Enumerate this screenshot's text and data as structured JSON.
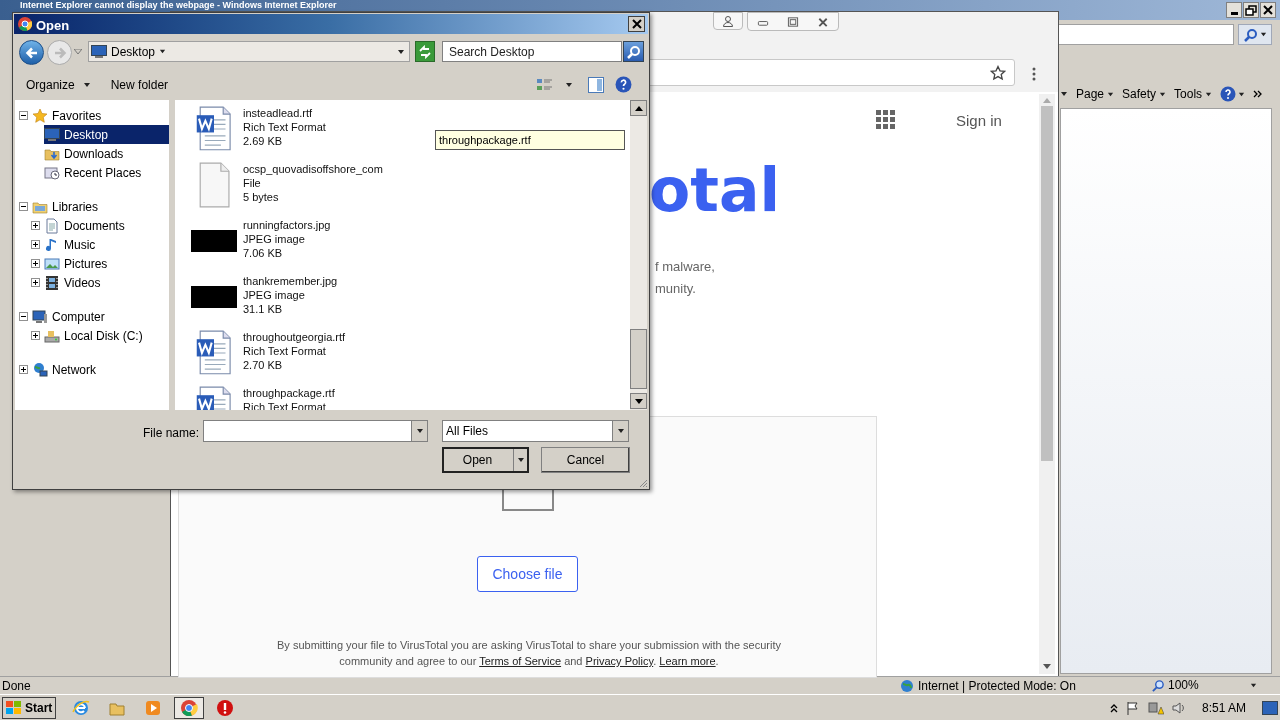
{
  "ie": {
    "title": "Internet Explorer cannot display the webpage - Windows Internet Explorer",
    "command_bar": [
      {
        "label": "Page"
      },
      {
        "label": "Safety"
      },
      {
        "label": "Tools"
      }
    ],
    "status": "Done",
    "zone": "Internet | Protected Mode: On",
    "zoom": "100%"
  },
  "browser": {
    "sign_in": "Sign in",
    "heading": "otal",
    "tagline": [
      "f malware,",
      "munity."
    ],
    "choose_file": "Choose file",
    "disclaimer": [
      {
        "text": "By submitting your file to VirusTotal you are asking VirusTotal to share your submission with the security community and agree to our "
      },
      {
        "text": "Terms of Service",
        "kind": "link"
      },
      {
        "text": " and "
      },
      {
        "text": "Privacy Policy",
        "kind": "link"
      },
      {
        "text": ". "
      },
      {
        "text": "Learn more",
        "kind": "link"
      },
      {
        "text": "."
      }
    ]
  },
  "dialog": {
    "title": "Open",
    "location": "Desktop",
    "search_placeholder": "Search Desktop",
    "toolbar": [
      "Organize",
      "New folder"
    ],
    "nav": [
      {
        "label": "Favorites",
        "expanded": true,
        "selected": false,
        "children": [
          {
            "label": "Desktop",
            "selected": true
          },
          {
            "label": "Downloads",
            "selected": false
          },
          {
            "label": "Recent Places",
            "selected": false
          }
        ]
      },
      {
        "label": "Libraries",
        "expanded": true,
        "selected": false,
        "children": [
          {
            "label": "Documents",
            "expanded": false,
            "selected": false
          },
          {
            "label": "Music",
            "expanded": false,
            "selected": false
          },
          {
            "label": "Pictures",
            "expanded": false,
            "selected": false
          },
          {
            "label": "Videos",
            "expanded": false,
            "selected": false
          }
        ]
      },
      {
        "label": "Computer",
        "expanded": true,
        "selected": false,
        "children": [
          {
            "label": "Local Disk (C:)",
            "expanded": false,
            "selected": false
          }
        ]
      },
      {
        "label": "Network",
        "expanded": false,
        "selected": false
      }
    ],
    "files": [
      {
        "name": "insteadlead.rtf",
        "type": "Rich Text Format",
        "size": "2.69 KB",
        "kind": "rtf"
      },
      {
        "name": "ocsp_quovadisoffshore_com",
        "type": "File",
        "size": "5 bytes",
        "kind": "blank"
      },
      {
        "name": "runningfactors.jpg",
        "type": "JPEG image",
        "size": "7.06 KB",
        "kind": "jpg"
      },
      {
        "name": "thankremember.jpg",
        "type": "JPEG image",
        "size": "31.1 KB",
        "kind": "jpg"
      },
      {
        "name": "throughoutgeorgia.rtf",
        "type": "Rich Text Format",
        "size": "2.70 KB",
        "kind": "rtf"
      },
      {
        "name": "throughpackage.rtf",
        "type": "Rich Text Format",
        "kind": "rtf"
      }
    ],
    "tooltip": "throughpackage.rtf",
    "file_name_label": "File name:",
    "file_type": "All Files",
    "buttons": [
      "Open",
      "Cancel"
    ]
  },
  "taskbar": {
    "start": "Start",
    "clock": "8:51 AM"
  }
}
